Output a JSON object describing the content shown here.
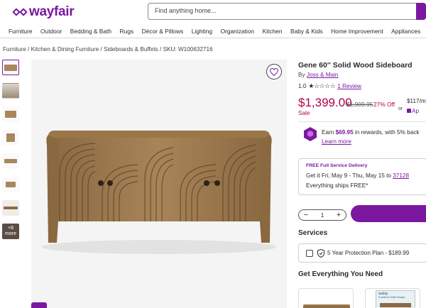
{
  "header": {
    "logo_text": "wayfair",
    "search_placeholder": "Find anything home..."
  },
  "nav": {
    "items": [
      "Furniture",
      "Outdoor",
      "Bedding & Bath",
      "Rugs",
      "Décor & Pillows",
      "Lighting",
      "Organization",
      "Kitchen",
      "Baby & Kids",
      "Home Improvement",
      "Appliances"
    ]
  },
  "breadcrumb": {
    "text": "Furniture / Kitchen & Dining Furniture / Sideboards & Buffets / SKU: W100632716"
  },
  "gallery": {
    "more_label": "more",
    "more_count": "+8"
  },
  "product": {
    "title": "Gene 60'' Solid Wood Sideboard",
    "by_prefix": "By ",
    "brand": "Joss & Main",
    "rating_value": "1.0",
    "rating_stars": 1,
    "rating_max": 5,
    "review_link": "1 Review",
    "price": "$1,399.00",
    "was_price": "$1,909.95",
    "discount": "27% Off",
    "sale_label": "Sale",
    "or_label": "or",
    "monthly": "$117/mo",
    "apply_label": "Ap"
  },
  "rewards": {
    "prefix": "Earn ",
    "amount": "$69.95",
    "suffix": " in rewards, with 5% back",
    "learn_more": "Learn more"
  },
  "delivery": {
    "label": "FREE Full Service Delivery",
    "get_it": "Get it Fri, May 9 - Thu, May 15 to ",
    "zip": "37128",
    "ships": "Everything ships FREE*"
  },
  "quantity": {
    "minus": "−",
    "value": "1",
    "plus": "+"
  },
  "services": {
    "heading": "Services",
    "protection": "5 Year Protection Plan - $189.99"
  },
  "recommendations": {
    "heading": "Get Everything You Need",
    "card2_brand": "Safely",
    "card2_text": "Furniture Wall Straps"
  },
  "colors": {
    "brand": "#7b189f",
    "sale": "#b1004b"
  }
}
